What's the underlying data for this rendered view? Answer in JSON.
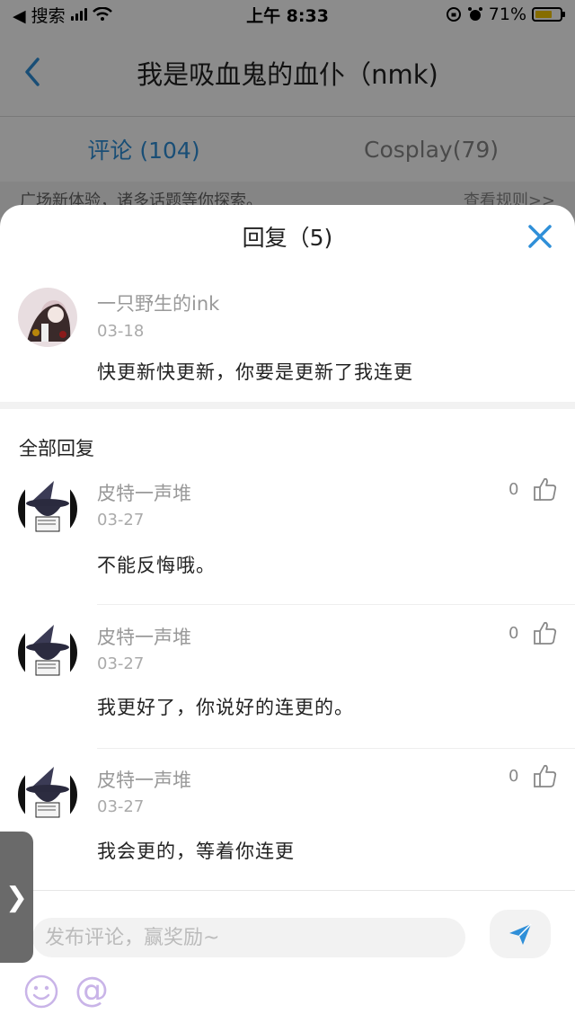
{
  "status_bar": {
    "back_app": "◀ 搜索",
    "time": "上午 8:33",
    "battery": "71%"
  },
  "nav": {
    "title": "我是吸血鬼的血仆（nmk)"
  },
  "tabs": [
    {
      "label": "评论 (104)",
      "active": true
    },
    {
      "label": "Cosplay(79)",
      "active": false
    }
  ],
  "notice": {
    "text": "广场新体验，诸多话题等你探索。",
    "link": "查看规则>>"
  },
  "sheet": {
    "title": "回复（5)",
    "main_comment": {
      "name": "一只野生的ink",
      "date": "03-18",
      "content": "快更新快更新，你要是更新了我连更"
    },
    "all_replies_label": "全部回复",
    "replies": [
      {
        "name": "皮特一声堆",
        "date": "03-27",
        "content": "不能反悔哦。",
        "likes": "0"
      },
      {
        "name": "皮特一声堆",
        "date": "03-27",
        "content": "我更好了，你说好的连更的。",
        "likes": "0"
      },
      {
        "name": "皮特一声堆",
        "date": "03-27",
        "content": "我会更的，等着你连更",
        "likes": "0"
      }
    ]
  },
  "input_bar": {
    "placeholder": "发布评论，赢奖励~",
    "at_symbol": "@"
  },
  "side_tab": {
    "label": "❯"
  },
  "colors": {
    "accent": "#2f8fd8",
    "send": "#2f8fd8",
    "muted_purple": "#c9b4e8"
  },
  "icons": {
    "back": "chevron-left-icon",
    "close": "close-icon",
    "like": "thumbs-up-icon",
    "send": "send-icon",
    "emoji": "smiley-icon"
  }
}
